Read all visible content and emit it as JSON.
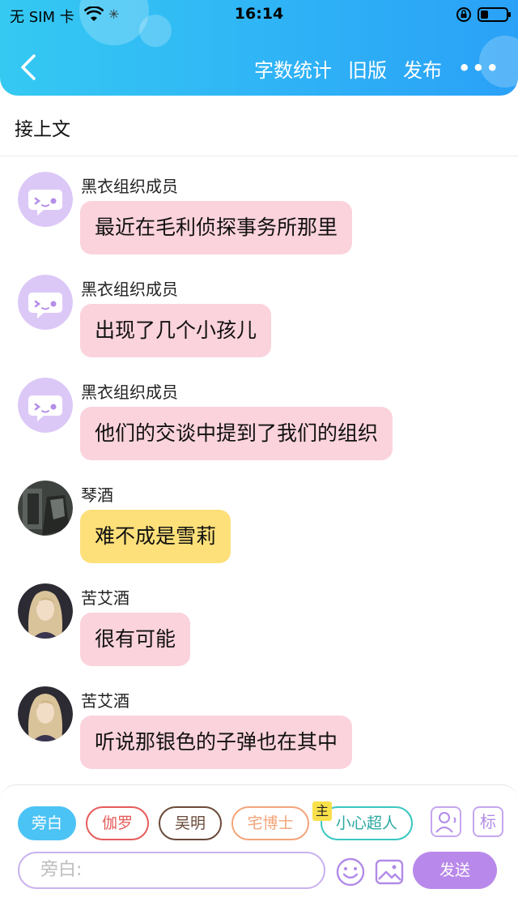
{
  "status_bar": {
    "carrier": "无 SIM 卡",
    "time": "16:14"
  },
  "nav": {
    "word_count_label": "字数统计",
    "old_version_label": "旧版",
    "publish_label": "发布",
    "more_label": "•••",
    "accent_color": "#2fb3f6"
  },
  "context_label": "接上文",
  "messages": [
    {
      "sender": "黑衣组织成员",
      "text": "最近在毛利侦探事务所那里",
      "bubble_color": "#fbd3dc",
      "avatar": "chat-bubble-icon"
    },
    {
      "sender": "黑衣组织成员",
      "text": "出现了几个小孩儿",
      "bubble_color": "#fbd3dc",
      "avatar": "chat-bubble-icon"
    },
    {
      "sender": "黑衣组织成员",
      "text": "他们的交谈中提到了我们的组织",
      "bubble_color": "#fbd3dc",
      "avatar": "chat-bubble-icon"
    },
    {
      "sender": "琴酒",
      "text": "难不成是雪莉",
      "bubble_color": "#fde07a",
      "avatar": "character-portrait"
    },
    {
      "sender": "苦艾酒",
      "text": "很有可能",
      "bubble_color": "#fbd3dc",
      "avatar": "character-portrait"
    },
    {
      "sender": "苦艾酒",
      "text": "听说那银色的子弹也在其中",
      "bubble_color": "#fbd3dc",
      "avatar": "character-portrait"
    }
  ],
  "roles": [
    {
      "label": "旁白",
      "active": true
    },
    {
      "label": "伽罗"
    },
    {
      "label": "吴明"
    },
    {
      "label": "宅博士"
    },
    {
      "label": "小心超人",
      "host_badge": "主"
    }
  ],
  "tools": {
    "label_icon_text": "标"
  },
  "composer": {
    "placeholder": "旁白:",
    "send_label": "发送"
  }
}
